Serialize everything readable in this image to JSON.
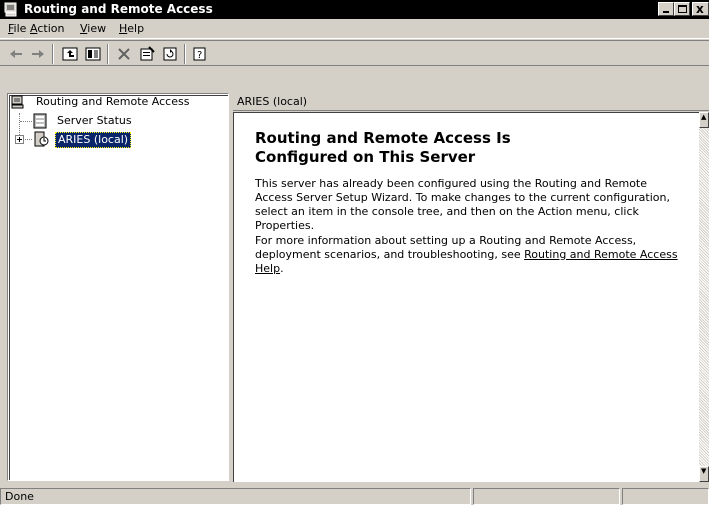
{
  "window": {
    "title": "Routing and Remote Access",
    "app_icon": "server-computer-icon"
  },
  "menu": {
    "items": [
      {
        "label": "File",
        "mnemonic": "F",
        "rest": "ile"
      },
      {
        "label": "Action",
        "mnemonic": "A",
        "rest": "ction"
      },
      {
        "label": "View",
        "mnemonic": "V",
        "rest": "iew"
      },
      {
        "label": "Help",
        "mnemonic": "H",
        "rest": "elp"
      }
    ]
  },
  "toolbar": {
    "buttons": [
      "back-icon",
      "forward-icon",
      "up-one-level-icon",
      "show-hide-tree-icon",
      "delete-icon",
      "properties-icon",
      "refresh-icon",
      "help-icon"
    ]
  },
  "tree": {
    "root_label": "Routing and Remote Access",
    "nodes": [
      {
        "label": "Server Status",
        "icon": "server-status-icon"
      },
      {
        "label": "ARIES (local)",
        "icon": "server-icon",
        "selected": true
      }
    ]
  },
  "content": {
    "header": "ARIES (local)",
    "heading_line1": "Routing and Remote Access Is",
    "heading_line2": "Configured on This Server",
    "paragraph1": "This server has already been configured using the Routing and Remote Access Server Setup Wizard. To make changes to the current configuration, select an item in the console tree, and then on the Action menu, click Properties.",
    "paragraph2_prefix": "For more information about setting up a Routing and Remote Access, deployment scenarios, and troubleshooting, see ",
    "help_link": "Routing and Remote Access Help",
    "paragraph2_suffix": "."
  },
  "status": {
    "text": "Done"
  }
}
